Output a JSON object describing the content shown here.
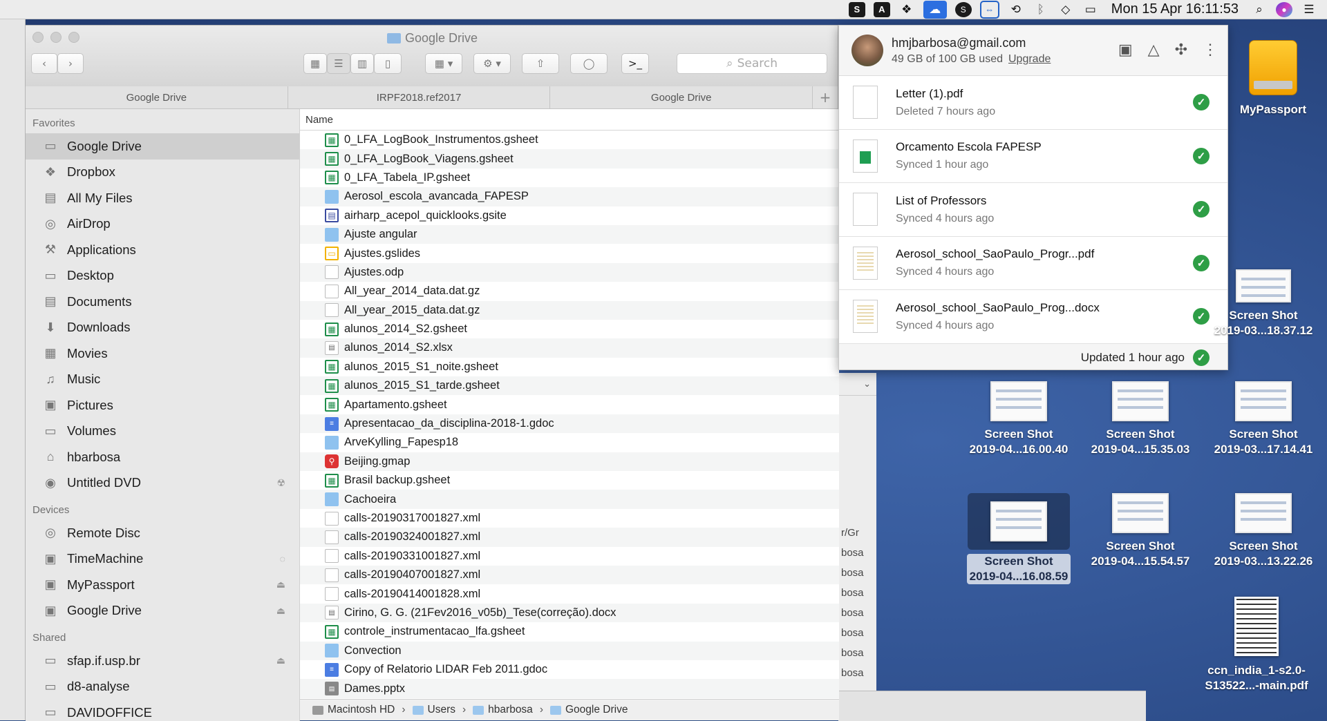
{
  "menubar": {
    "clock": "Mon 15 Apr  16:11:53",
    "icons": [
      "skype-icon",
      "app-icon",
      "dropbox-icon",
      "google-drive-sync-icon",
      "s-icon",
      "teamviewer-icon",
      "time-machine-icon",
      "bluetooth-icon",
      "wifi-icon",
      "airplay-icon",
      "search-icon",
      "siri-icon",
      "notification-center-icon"
    ]
  },
  "finder": {
    "title": "Google Drive",
    "search_placeholder": "Search",
    "tabs": [
      "Google Drive",
      "IRPF2018.ref2017",
      "Google Drive"
    ],
    "tab_add": "+",
    "sidebar": {
      "favorites_header": "Favorites",
      "favorites": [
        "Google Drive",
        "Dropbox",
        "All My Files",
        "AirDrop",
        "Applications",
        "Desktop",
        "Documents",
        "Downloads",
        "Movies",
        "Music",
        "Pictures",
        "Volumes",
        "hbarbosa",
        "Untitled DVD"
      ],
      "devices_header": "Devices",
      "devices": [
        "Remote Disc",
        "TimeMachine",
        "MyPassport",
        "Google Drive"
      ],
      "shared_header": "Shared",
      "shared": [
        "sfap.if.usp.br",
        "d8-analyse",
        "DAVIDOFFICE"
      ]
    },
    "column_name": "Name",
    "files": [
      {
        "name": "0_LFA_LogBook_Instrumentos.gsheet",
        "kind": "sheet"
      },
      {
        "name": "0_LFA_LogBook_Viagens.gsheet",
        "kind": "sheet"
      },
      {
        "name": "0_LFA_Tabela_IP.gsheet",
        "kind": "sheet"
      },
      {
        "name": "Aerosol_escola_avancada_FAPESP",
        "kind": "folder"
      },
      {
        "name": "airharp_acepol_quicklooks.gsite",
        "kind": "site"
      },
      {
        "name": "Ajuste angular",
        "kind": "folder"
      },
      {
        "name": "Ajustes.gslides",
        "kind": "slides"
      },
      {
        "name": "Ajustes.odp",
        "kind": "doc"
      },
      {
        "name": "All_year_2014_data.dat.gz",
        "kind": "doc"
      },
      {
        "name": "All_year_2015_data.dat.gz",
        "kind": "doc"
      },
      {
        "name": "alunos_2014_S2.gsheet",
        "kind": "sheet"
      },
      {
        "name": "alunos_2014_S2.xlsx",
        "kind": "xlsx"
      },
      {
        "name": "alunos_2015_S1_noite.gsheet",
        "kind": "sheet"
      },
      {
        "name": "alunos_2015_S1_tarde.gsheet",
        "kind": "sheet"
      },
      {
        "name": "Apartamento.gsheet",
        "kind": "sheet"
      },
      {
        "name": "Apresentacao_da_disciplina-2018-1.gdoc",
        "kind": "gdoc"
      },
      {
        "name": "ArveKylling_Fapesp18",
        "kind": "folder"
      },
      {
        "name": "Beijing.gmap",
        "kind": "map"
      },
      {
        "name": "Brasil backup.gsheet",
        "kind": "sheet"
      },
      {
        "name": "Cachoeira",
        "kind": "folder"
      },
      {
        "name": "calls-20190317001827.xml",
        "kind": "doc"
      },
      {
        "name": "calls-20190324001827.xml",
        "kind": "doc"
      },
      {
        "name": "calls-20190331001827.xml",
        "kind": "doc"
      },
      {
        "name": "calls-20190407001827.xml",
        "kind": "doc"
      },
      {
        "name": "calls-20190414001828.xml",
        "kind": "doc"
      },
      {
        "name": "Cirino, G. G. (21Fev2016_v05b)_Tese(correção).docx",
        "kind": "xlsx"
      },
      {
        "name": "controle_instrumentacao_lfa.gsheet",
        "kind": "sheet"
      },
      {
        "name": "Convection",
        "kind": "folder"
      },
      {
        "name": "Copy of Relatorio LIDAR Feb 2011.gdoc",
        "kind": "gdoc"
      },
      {
        "name": "Dames.pptx",
        "kind": "pptx"
      }
    ],
    "path": [
      "Macintosh HD",
      "Users",
      "hbarbosa",
      "Google Drive"
    ]
  },
  "drive_popup": {
    "email": "hmjbarbosa@gmail.com",
    "usage": "49 GB of 100 GB used",
    "upgrade": "Upgrade",
    "items": [
      {
        "name": "Letter (1).pdf",
        "status": "Deleted 7 hours ago",
        "thumb": "blank"
      },
      {
        "name": "Orcamento Escola FAPESP",
        "status": "Synced 1 hour ago",
        "thumb": "sheet"
      },
      {
        "name": "List of Professors",
        "status": "Synced 4 hours ago",
        "thumb": "blank"
      },
      {
        "name": "Aerosol_school_SaoPaulo_Progr...pdf",
        "status": "Synced 4 hours ago",
        "thumb": "doc"
      },
      {
        "name": "Aerosol_school_SaoPaulo_Prog...docx",
        "status": "Synced 4 hours ago",
        "thumb": "doc"
      }
    ],
    "footer": "Updated 1 hour ago"
  },
  "bg_window": {
    "lines": [
      "r/Gr",
      "bosa",
      "bosa",
      "bosa",
      "bosa",
      "bosa",
      "bosa",
      "bosa"
    ]
  },
  "desktop": {
    "mypassport": "MyPassport",
    "shots": [
      {
        "line1": "Screen Shot",
        "line2": "2019-03...18.37.12"
      },
      {
        "line1": "Screen Shot",
        "line2": "2019-04...16.00.40"
      },
      {
        "line1": "Screen Shot",
        "line2": "2019-04...15.35.03"
      },
      {
        "line1": "Screen Shot",
        "line2": "2019-03...17.14.41"
      },
      {
        "line1": "Screen Shot",
        "line2": "2019-04...16.08.59"
      },
      {
        "line1": "Screen Shot",
        "line2": "2019-04...15.54.57"
      },
      {
        "line1": "Screen Shot",
        "line2": "2019-03...13.22.26"
      }
    ],
    "pdf": {
      "line1": "ccn_india_1-s2.0-",
      "line2": "S13522...-main.pdf"
    }
  }
}
